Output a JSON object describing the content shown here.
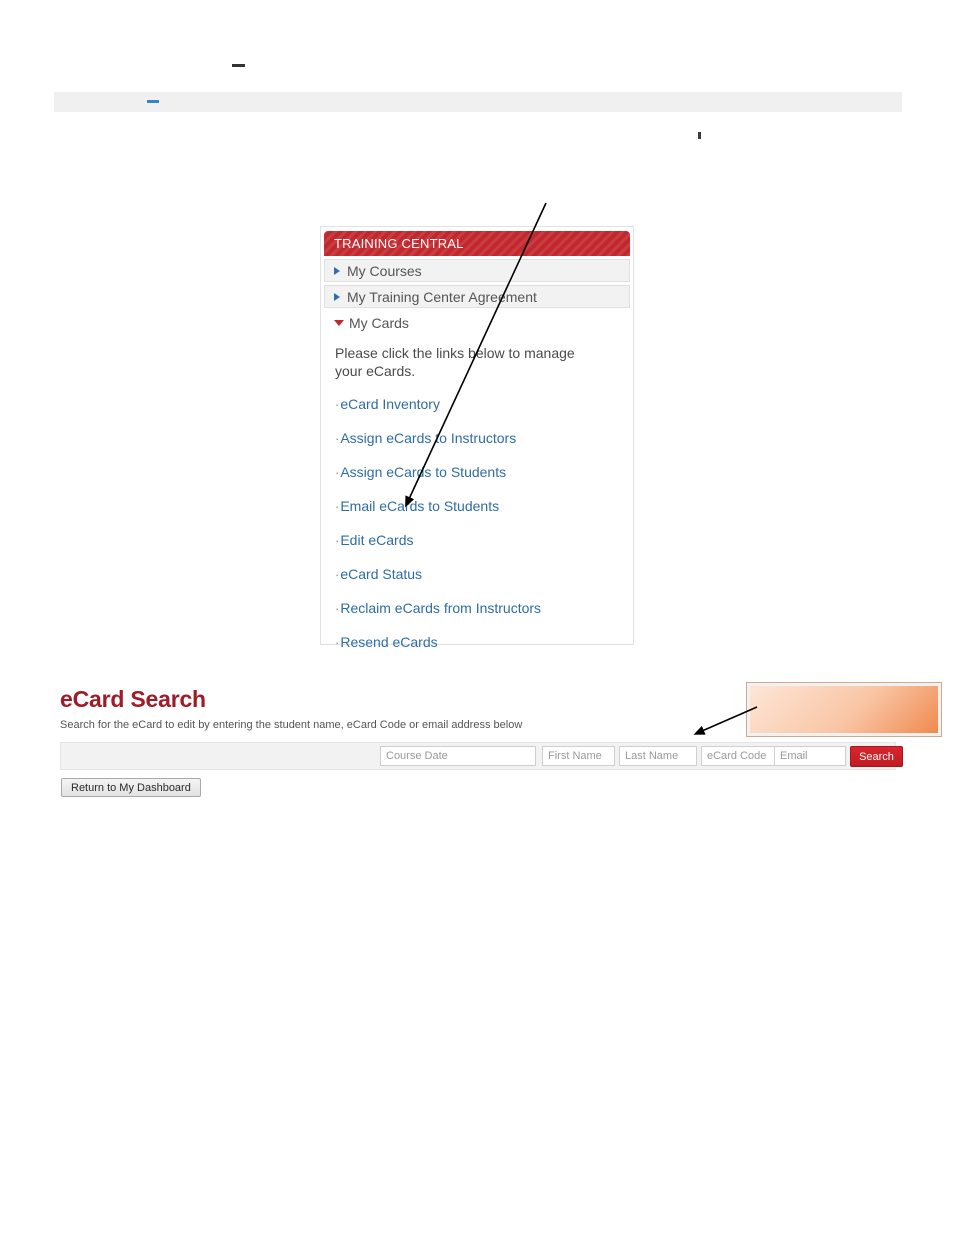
{
  "top_fragments": {
    "dark_dash": "",
    "blue_dash": "",
    "comma_mark": ""
  },
  "training_panel": {
    "header_title": "TRAINING CENTRAL",
    "accordion_items": [
      {
        "label": "My Courses",
        "expanded": false,
        "marker": "triangle-right-icon"
      },
      {
        "label": "My Training Center Agreement",
        "expanded": false,
        "marker": "triangle-right-icon"
      },
      {
        "label": "My Cards",
        "expanded": true,
        "marker": "triangle-down-icon"
      }
    ],
    "intro_text": "Please click the links below to manage your eCards.",
    "links": [
      {
        "label": "eCard Inventory"
      },
      {
        "label": "Assign eCards to Instructors"
      },
      {
        "label": "Assign eCards to Students"
      },
      {
        "label": "Email eCards to Students"
      },
      {
        "label": "Edit eCards"
      },
      {
        "label": "eCard Status"
      },
      {
        "label": "Reclaim eCards from Instructors"
      },
      {
        "label": "Resend eCards"
      }
    ],
    "bullet": "·"
  },
  "ecard_search": {
    "title": "eCard Search",
    "subtitle": "Search for the eCard to edit by entering the student name, eCard Code or email address below",
    "fields": [
      {
        "name": "course-date",
        "placeholder": "Course Date",
        "value": ""
      },
      {
        "name": "first-name",
        "placeholder": "First Name",
        "value": ""
      },
      {
        "name": "last-name",
        "placeholder": "Last Name",
        "value": ""
      },
      {
        "name": "ecard-code",
        "placeholder": "eCard Code",
        "value": ""
      },
      {
        "name": "email",
        "placeholder": "Email",
        "value": ""
      }
    ],
    "search_button_label": "Search",
    "return_button_label": "Return to My Dashboard"
  },
  "callout": {
    "text": "",
    "border_color": "#cbab93",
    "gradient_start": "#fde6d7",
    "gradient_end": "#f08a4f"
  },
  "colors": {
    "brand_red": "#c1272d",
    "title_red": "#9e1b28",
    "link_blue": "#2e6da4",
    "panel_gray": "#f2f2f2",
    "band_gray": "#f0f0f0",
    "search_button_red": "#c01c22"
  }
}
